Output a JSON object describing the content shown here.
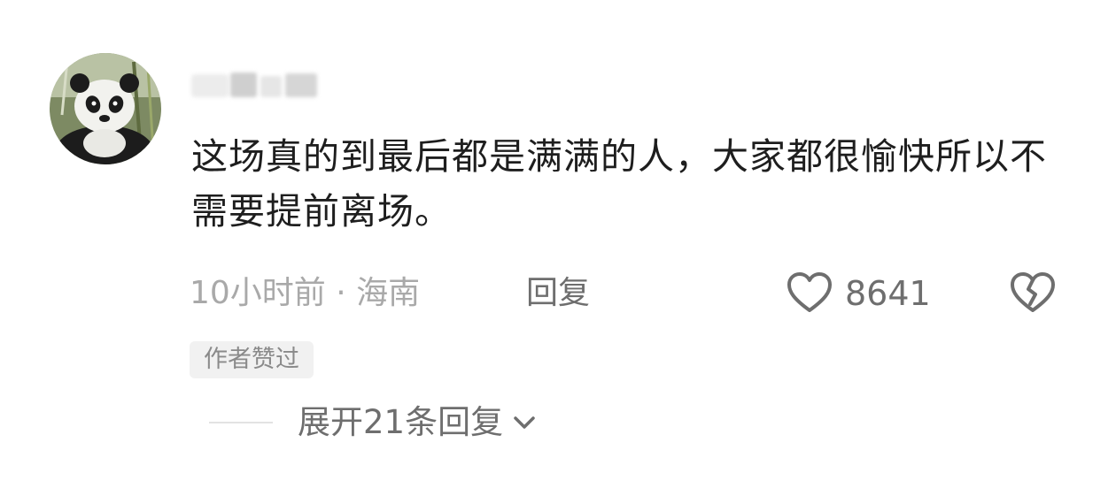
{
  "comment": {
    "avatar_icon": "panda-avatar-icon",
    "username": "",
    "text": "这场真的到最后都是满满的人，大家都很愉快所以不需要提前离场。",
    "meta": "10小时前 · 海南",
    "reply_label": "回复",
    "like_icon": "heart-outline-icon",
    "like_count": "8641",
    "dislike_icon": "broken-heart-icon",
    "author_badge": "作者赞过",
    "expand_label": "展开21条回复",
    "expand_icon": "chevron-down-icon"
  },
  "colors": {
    "text_primary": "#1e1e1e",
    "text_meta": "#a9a9a9",
    "text_secondary": "#6e6e6e",
    "badge_bg": "#f1f1f1"
  }
}
